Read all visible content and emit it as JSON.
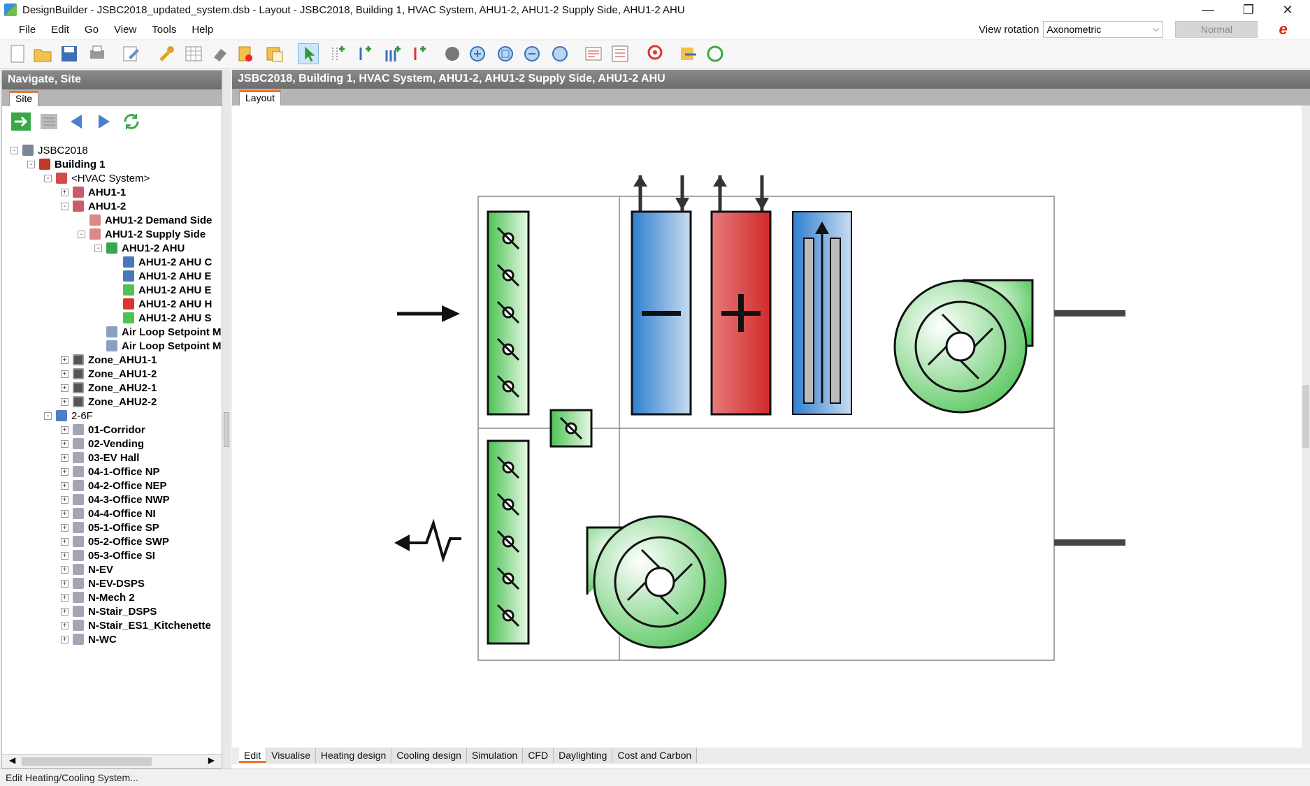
{
  "window": {
    "title": "DesignBuilder - JSBC2018_updated_system.dsb - Layout - JSBC2018, Building 1, HVAC System, AHU1-2, AHU1-2 Supply Side, AHU1-2 AHU",
    "minimize": "—",
    "restore": "❐",
    "close": "✕"
  },
  "menu": [
    "File",
    "Edit",
    "Go",
    "View",
    "Tools",
    "Help"
  ],
  "view_rotation": {
    "label": "View rotation",
    "value": "Axonometric",
    "normal_button": "Normal"
  },
  "left_panel": {
    "header": "Navigate, Site",
    "tab": "Site"
  },
  "tree": [
    {
      "label": "JSBC2018",
      "bold": false,
      "exp": "-",
      "icon": "site"
    },
    {
      "label": "Building 1",
      "bold": true,
      "exp": "-",
      "icon": "bld"
    },
    {
      "label": "<HVAC System>",
      "bold": false,
      "exp": "-",
      "icon": "hvac"
    },
    {
      "label": "AHU1-1",
      "bold": true,
      "exp": "+",
      "icon": "ahu"
    },
    {
      "label": "AHU1-2",
      "bold": true,
      "exp": "-",
      "icon": "ahu"
    },
    {
      "label": "AHU1-2 Demand Side",
      "bold": true,
      "exp": "",
      "icon": "demand"
    },
    {
      "label": "AHU1-2 Supply Side",
      "bold": true,
      "exp": "-",
      "icon": "demand"
    },
    {
      "label": "AHU1-2 AHU",
      "bold": true,
      "exp": "-",
      "icon": "green"
    },
    {
      "label": "AHU1-2 AHU C",
      "bold": true,
      "exp": "",
      "icon": "blue"
    },
    {
      "label": "AHU1-2 AHU E",
      "bold": true,
      "exp": "",
      "icon": "blue"
    },
    {
      "label": "AHU1-2 AHU E",
      "bold": true,
      "exp": "",
      "icon": "circ"
    },
    {
      "label": "AHU1-2 AHU H",
      "bold": true,
      "exp": "",
      "icon": "red"
    },
    {
      "label": "AHU1-2 AHU S",
      "bold": true,
      "exp": "",
      "icon": "circ"
    },
    {
      "label": "Air Loop Setpoint M",
      "bold": true,
      "exp": "",
      "icon": "pipe"
    },
    {
      "label": "Air Loop Setpoint M",
      "bold": true,
      "exp": "",
      "icon": "pipe"
    },
    {
      "label": "Zone_AHU1-1",
      "bold": true,
      "exp": "+",
      "icon": "zone"
    },
    {
      "label": "Zone_AHU1-2",
      "bold": true,
      "exp": "+",
      "icon": "zone"
    },
    {
      "label": "Zone_AHU2-1",
      "bold": true,
      "exp": "+",
      "icon": "zone"
    },
    {
      "label": "Zone_AHU2-2",
      "bold": true,
      "exp": "+",
      "icon": "zone"
    },
    {
      "label": "2-6F",
      "bold": false,
      "exp": "-",
      "icon": "block"
    },
    {
      "label": "01-Corridor",
      "bold": true,
      "exp": "+",
      "icon": "room"
    },
    {
      "label": "02-Vending",
      "bold": true,
      "exp": "+",
      "icon": "room"
    },
    {
      "label": "03-EV Hall",
      "bold": true,
      "exp": "+",
      "icon": "room"
    },
    {
      "label": "04-1-Office NP",
      "bold": true,
      "exp": "+",
      "icon": "room"
    },
    {
      "label": "04-2-Office NEP",
      "bold": true,
      "exp": "+",
      "icon": "room"
    },
    {
      "label": "04-3-Office NWP",
      "bold": true,
      "exp": "+",
      "icon": "room"
    },
    {
      "label": "04-4-Office NI",
      "bold": true,
      "exp": "+",
      "icon": "room"
    },
    {
      "label": "05-1-Office SP",
      "bold": true,
      "exp": "+",
      "icon": "room"
    },
    {
      "label": "05-2-Office SWP",
      "bold": true,
      "exp": "+",
      "icon": "room"
    },
    {
      "label": "05-3-Office SI",
      "bold": true,
      "exp": "+",
      "icon": "room"
    },
    {
      "label": "N-EV",
      "bold": true,
      "exp": "+",
      "icon": "room"
    },
    {
      "label": "N-EV-DSPS",
      "bold": true,
      "exp": "+",
      "icon": "room"
    },
    {
      "label": "N-Mech 2",
      "bold": true,
      "exp": "+",
      "icon": "room"
    },
    {
      "label": "N-Stair_DSPS",
      "bold": true,
      "exp": "+",
      "icon": "room"
    },
    {
      "label": "N-Stair_ES1_Kitchenette",
      "bold": true,
      "exp": "+",
      "icon": "room"
    },
    {
      "label": "N-WC",
      "bold": true,
      "exp": "+",
      "icon": "room"
    }
  ],
  "right_panel": {
    "header": "JSBC2018, Building 1, HVAC System, AHU1-2, AHU1-2 Supply Side, AHU1-2 AHU",
    "tab": "Layout"
  },
  "bottom_tabs": [
    "Edit",
    "Visualise",
    "Heating design",
    "Cooling design",
    "Simulation",
    "CFD",
    "Daylighting",
    "Cost and Carbon"
  ],
  "status": "Edit Heating/Cooling System...",
  "colors": {
    "accent_orange": "#e8772e",
    "component_green": "#4cc354",
    "cooling_blue": "#3b86d0",
    "heating_red": "#d94444"
  }
}
